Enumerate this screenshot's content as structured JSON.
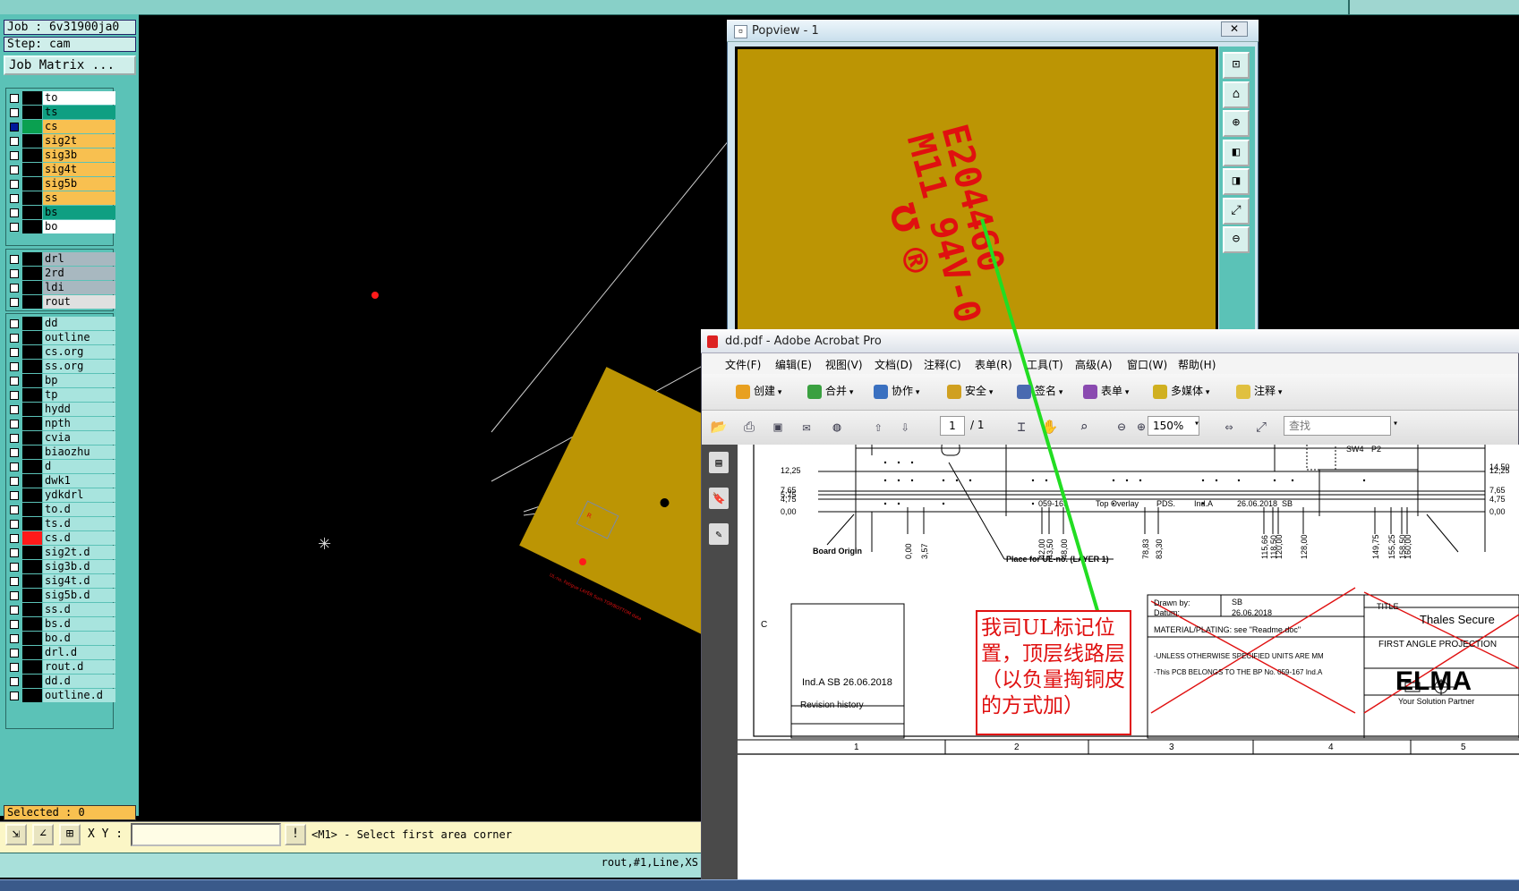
{
  "genesis": {
    "job_label": "Job : 6v31900ja0",
    "step_label": "Step: cam",
    "job_matrix_button": "Job Matrix ...",
    "layer_group_1": [
      {
        "name": "to",
        "color": "#ffffff",
        "mark": "↙",
        "swatch": "#000000"
      },
      {
        "name": "ts",
        "color": "#0f9f82",
        "mark": "",
        "swatch": "#000000"
      },
      {
        "name": "cs",
        "color": "#f8c050",
        "mark": "m",
        "swatch": "#0aa050",
        "checked_color": "#001a9a"
      },
      {
        "name": "sig2t",
        "color": "#f8c050",
        "mark": "↙",
        "swatch": "#000000"
      },
      {
        "name": "sig3b",
        "color": "#f8c050",
        "mark": "",
        "swatch": "#000000"
      },
      {
        "name": "sig4t",
        "color": "#f8c050",
        "mark": "↙",
        "swatch": "#000000"
      },
      {
        "name": "sig5b",
        "color": "#f8c050",
        "mark": "",
        "swatch": "#000000"
      },
      {
        "name": "ss",
        "color": "#f8c050",
        "mark": "",
        "swatch": "#000000"
      },
      {
        "name": "bs",
        "color": "#0f9f82",
        "mark": "",
        "swatch": "#000000"
      },
      {
        "name": "bo",
        "color": "#ffffff",
        "mark": "",
        "swatch": "#000000"
      }
    ],
    "layer_group_2": [
      {
        "name": "drl",
        "color": "#a8b8c0",
        "mark": "",
        "swatch": "#000000"
      },
      {
        "name": "2rd",
        "color": "#a8b8c0",
        "mark": "",
        "swatch": "#000000"
      },
      {
        "name": "ldi",
        "color": "#a8b8c0",
        "mark": "",
        "swatch": "#000000"
      },
      {
        "name": "rout",
        "color": "#e0e0e0",
        "mark": "",
        "swatch": "#000000"
      }
    ],
    "layer_group_3": [
      {
        "name": "dd",
        "color": "#a8e4de",
        "mark": "↙",
        "swatch": "#000000"
      },
      {
        "name": "outline",
        "color": "#a8e4de",
        "mark": "",
        "swatch": "#000000"
      },
      {
        "name": "cs.org",
        "color": "#a8e4de",
        "mark": "",
        "swatch": "#000000"
      },
      {
        "name": "ss.org",
        "color": "#a8e4de",
        "mark": "",
        "swatch": "#000000"
      },
      {
        "name": "bp",
        "color": "#a8e4de",
        "mark": "",
        "swatch": "#000000"
      },
      {
        "name": "tp",
        "color": "#a8e4de",
        "mark": "",
        "swatch": "#000000"
      },
      {
        "name": "hydd",
        "color": "#a8e4de",
        "mark": "",
        "swatch": "#000000"
      },
      {
        "name": "npth",
        "color": "#a8e4de",
        "mark": "",
        "swatch": "#000000"
      },
      {
        "name": "cvia",
        "color": "#a8e4de",
        "mark": "",
        "swatch": "#000000"
      },
      {
        "name": "biaozhu",
        "color": "#a8e4de",
        "mark": "",
        "swatch": "#000000"
      },
      {
        "name": "d",
        "color": "#a8e4de",
        "mark": "",
        "swatch": "#000000"
      },
      {
        "name": "dwk1",
        "color": "#a8e4de",
        "mark": "",
        "swatch": "#000000"
      },
      {
        "name": "ydkdrl",
        "color": "#a8e4de",
        "mark": "",
        "swatch": "#000000"
      },
      {
        "name": "to.d",
        "color": "#a8e4de",
        "mark": "↙",
        "swatch": "#000000"
      },
      {
        "name": "ts.d",
        "color": "#a8e4de",
        "mark": "",
        "swatch": "#000000"
      },
      {
        "name": "cs.d",
        "color": "#a8e4de",
        "mark": "",
        "swatch": "#ff1a1a"
      },
      {
        "name": "sig2t.d",
        "color": "#a8e4de",
        "mark": "↙",
        "swatch": "#000000"
      },
      {
        "name": "sig3b.d",
        "color": "#a8e4de",
        "mark": "",
        "swatch": "#000000"
      },
      {
        "name": "sig4t.d",
        "color": "#a8e4de",
        "mark": "↙",
        "swatch": "#000000"
      },
      {
        "name": "sig5b.d",
        "color": "#a8e4de",
        "mark": "",
        "swatch": "#000000"
      },
      {
        "name": "ss.d",
        "color": "#a8e4de",
        "mark": "",
        "swatch": "#000000"
      },
      {
        "name": "bs.d",
        "color": "#a8e4de",
        "mark": "",
        "swatch": "#000000"
      },
      {
        "name": "bo.d",
        "color": "#a8e4de",
        "mark": "",
        "swatch": "#000000"
      },
      {
        "name": "drl.d",
        "color": "#a8e4de",
        "mark": "",
        "swatch": "#000000"
      },
      {
        "name": "rout.d",
        "color": "#a8e4de",
        "mark": "",
        "swatch": "#000000"
      },
      {
        "name": "dd.d",
        "color": "#a8e4de",
        "mark": "↙",
        "swatch": "#000000"
      },
      {
        "name": "outline.d",
        "color": "#a8e4de",
        "mark": "",
        "swatch": "#000000"
      }
    ],
    "selected_label": "Selected : 0",
    "xy_label": "X Y :",
    "xy_value": "",
    "command_prompt": "<M1> - Select first area corner",
    "status_text": "rout,#1,Line,XS",
    "board_color": "#bc9504"
  },
  "popview": {
    "title": "Popview - 1",
    "close_label": "✕",
    "ul_text_line1": "E204460",
    "ul_text_line2": "M11 94V-0",
    "tool_icons": [
      "fit-icon",
      "zoom-home-icon",
      "zoom-in-icon",
      "pan-left-icon",
      "pan-right-icon",
      "zoom-window-icon",
      "zoom-out-icon"
    ]
  },
  "acrobat": {
    "title": "dd.pdf - Adobe Acrobat Pro",
    "menu": [
      "文件(F)",
      "编辑(E)",
      "视图(V)",
      "文档(D)",
      "注释(C)",
      "表单(R)",
      "工具(T)",
      "高级(A)",
      "窗口(W)",
      "帮助(H)"
    ],
    "toolbar1": [
      {
        "label": "创建",
        "color": "#e8a020"
      },
      {
        "label": "合并",
        "color": "#3aa040"
      },
      {
        "label": "协作",
        "color": "#3a70c0"
      },
      {
        "label": "安全",
        "color": "#d0a020"
      },
      {
        "label": "签名",
        "color": "#4a6ab0"
      },
      {
        "label": "表单",
        "color": "#8a4ab0"
      },
      {
        "label": "多媒体",
        "color": "#d0b020"
      },
      {
        "label": "注释",
        "color": "#e0c040"
      }
    ],
    "page_current": "1",
    "page_total": "/ 1",
    "zoom": "150%",
    "find_placeholder": "查找",
    "drawing": {
      "y_dims_left": [
        "12,25",
        "7,65",
        "5,75",
        "4,75",
        "0,00"
      ],
      "y_dims_right": [
        "14,50",
        "12,25",
        "7,65",
        "4,75",
        "0,00"
      ],
      "x_dims": [
        "0,00",
        "3,57",
        "42,00",
        "43,50",
        "48,00",
        "78,83",
        "83,30",
        "115,66",
        "118,50",
        "120,00",
        "128,00",
        "149,75",
        "155,25",
        "158,50",
        "160,00"
      ],
      "board_origin": "Board Origin",
      "place_note": "Place for UL-no. (LAYER 1)",
      "legend_line": [
        "059-169",
        "Top Overlay",
        "PDS.",
        "Ind.A",
        "26.06.2018",
        "SB"
      ],
      "sw_label": "SW4",
      "p_label": "P2",
      "rev_row": "Ind.A   SB   26.06.2018",
      "rev_label": "Revision    history",
      "c_label": "C",
      "drawn_by_label": "Drawn by:",
      "drawn_by": "SB",
      "datum_label": "Datum:",
      "datum": "26.06.2018",
      "material": "MATERIAL/PLATING: see \"Readme.doc\"",
      "unless": "-UNLESS OTHERWISE SPECIFIED UNITS ARE MM",
      "belongs": "-This PCB BELONGS TO THE BP No. 059-167 Ind.A",
      "title_label": "TITLE",
      "title_value": "Thales Secure",
      "projection": "FIRST ANGLE PROJECTION",
      "elma": "ELMA",
      "elma_tag": "Your Solution Partner",
      "columns": [
        "1",
        "2",
        "3",
        "4",
        "5"
      ]
    },
    "annotation": "我司UL标记位置，顶层线路层（以负量掏铜皮的方式加）"
  }
}
